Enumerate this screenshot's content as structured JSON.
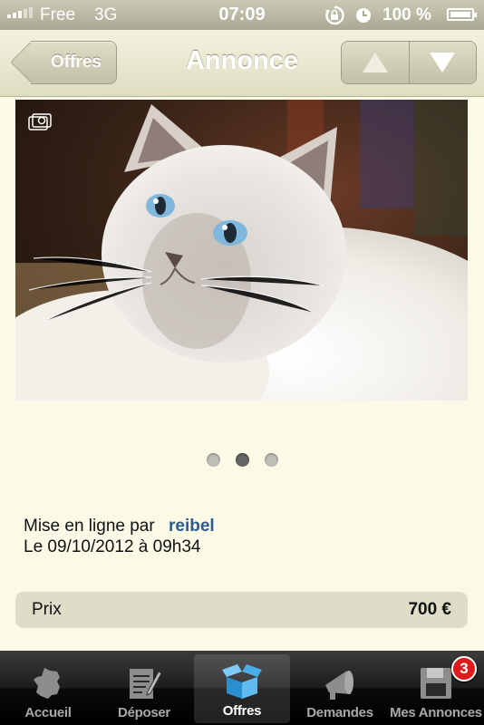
{
  "status_bar": {
    "carrier": "Free",
    "network": "3G",
    "time": "07:09",
    "battery_percent": "100 %"
  },
  "nav": {
    "back_label": "Offres",
    "title": "Annonce"
  },
  "gallery": {
    "page_count": 3,
    "active_index": 1
  },
  "listing": {
    "posted_by_prefix": "Mise en ligne par",
    "author": "reibel",
    "posted_date": "Le 09/10/2012 à 09h34",
    "price_label": "Prix",
    "price_value": "700 €"
  },
  "tabs": [
    {
      "label": "Accueil",
      "icon": "france-map-icon"
    },
    {
      "label": "Déposer",
      "icon": "notepad-pen-icon"
    },
    {
      "label": "Offres",
      "icon": "open-box-icon",
      "active": true
    },
    {
      "label": "Demandes",
      "icon": "megaphone-icon"
    },
    {
      "label": "Mes Annonces",
      "icon": "floppy-disk-icon",
      "badge": "3"
    }
  ],
  "colors": {
    "background": "#fbfae6",
    "author_link": "#2f5b8f",
    "badge": "#e0191b",
    "active_tab_icon": "#3aa6e0"
  }
}
